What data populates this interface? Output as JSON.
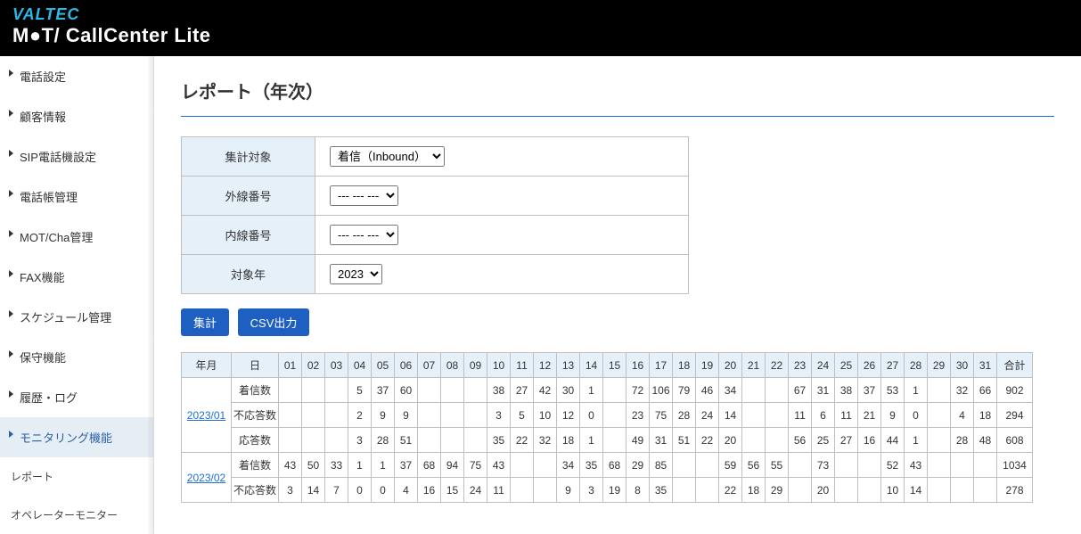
{
  "brand": {
    "top": "VALTEC",
    "main": "M●T/ CallCenter Lite"
  },
  "nav": {
    "items": [
      {
        "label": "電話設定",
        "caret": true
      },
      {
        "label": "顧客情報",
        "caret": true
      },
      {
        "label": "SIP電話機設定",
        "caret": true
      },
      {
        "label": "電話帳管理",
        "caret": true
      },
      {
        "label": "MOT/Cha管理",
        "caret": true
      },
      {
        "label": "FAX機能",
        "caret": true
      },
      {
        "label": "スケジュール管理",
        "caret": true
      },
      {
        "label": "保守機能",
        "caret": true
      },
      {
        "label": "履歴・ログ",
        "caret": true
      },
      {
        "label": "モニタリング機能",
        "caret": true,
        "active": true
      },
      {
        "label": "レポート",
        "caret": false,
        "sub": true
      },
      {
        "label": "オペレーターモニター",
        "caret": false,
        "sub": true
      }
    ]
  },
  "page": {
    "title": "レポート（年次）"
  },
  "filters": {
    "target_label": "集計対象",
    "target_value": "着信（Inbound）",
    "ext_label": "外線番号",
    "ext_value": "--- --- ---",
    "int_label": "内線番号",
    "int_value": "--- --- ---",
    "year_label": "対象年",
    "year_value": "2023"
  },
  "buttons": {
    "aggregate": "集計",
    "csv": "CSV出力"
  },
  "table": {
    "headers": [
      "年月",
      "日",
      "01",
      "02",
      "03",
      "04",
      "05",
      "06",
      "07",
      "08",
      "09",
      "10",
      "11",
      "12",
      "13",
      "14",
      "15",
      "16",
      "17",
      "18",
      "19",
      "20",
      "21",
      "22",
      "23",
      "24",
      "25",
      "26",
      "27",
      "28",
      "29",
      "30",
      "31",
      "合計"
    ],
    "rows": [
      {
        "ym": "2023/01",
        "sub": "着信数",
        "vals": [
          "",
          "",
          "",
          "5",
          "37",
          "60",
          "",
          "",
          "",
          "38",
          "27",
          "42",
          "30",
          "1",
          "",
          "72",
          "106",
          "79",
          "46",
          "34",
          "",
          "",
          "67",
          "31",
          "38",
          "37",
          "53",
          "1",
          "",
          "32",
          "66"
        ],
        "total": "902"
      },
      {
        "ym": "",
        "sub": "不応答数",
        "vals": [
          "",
          "",
          "",
          "2",
          "9",
          "9",
          "",
          "",
          "",
          "3",
          "5",
          "10",
          "12",
          "0",
          "",
          "23",
          "75",
          "28",
          "24",
          "14",
          "",
          "",
          "11",
          "6",
          "11",
          "21",
          "9",
          "0",
          "",
          "4",
          "18"
        ],
        "total": "294"
      },
      {
        "ym": "",
        "sub": "応答数",
        "vals": [
          "",
          "",
          "",
          "3",
          "28",
          "51",
          "",
          "",
          "",
          "35",
          "22",
          "32",
          "18",
          "1",
          "",
          "49",
          "31",
          "51",
          "22",
          "20",
          "",
          "",
          "56",
          "25",
          "27",
          "16",
          "44",
          "1",
          "",
          "28",
          "48"
        ],
        "total": "608"
      },
      {
        "ym": "2023/02",
        "sub": "着信数",
        "vals": [
          "43",
          "50",
          "33",
          "1",
          "1",
          "37",
          "68",
          "94",
          "75",
          "43",
          "",
          "",
          "34",
          "35",
          "68",
          "29",
          "85",
          "",
          "",
          "59",
          "56",
          "55",
          "",
          "73",
          "",
          "",
          "52",
          "43",
          "",
          "",
          ""
        ],
        "total": "1034"
      },
      {
        "ym": "",
        "sub": "不応答数",
        "vals": [
          "3",
          "14",
          "7",
          "0",
          "0",
          "4",
          "16",
          "15",
          "24",
          "11",
          "",
          "",
          "9",
          "3",
          "19",
          "8",
          "35",
          "",
          "",
          "22",
          "18",
          "29",
          "",
          "20",
          "",
          "",
          "10",
          "14",
          "",
          "",
          ""
        ],
        "total": "278"
      }
    ]
  }
}
